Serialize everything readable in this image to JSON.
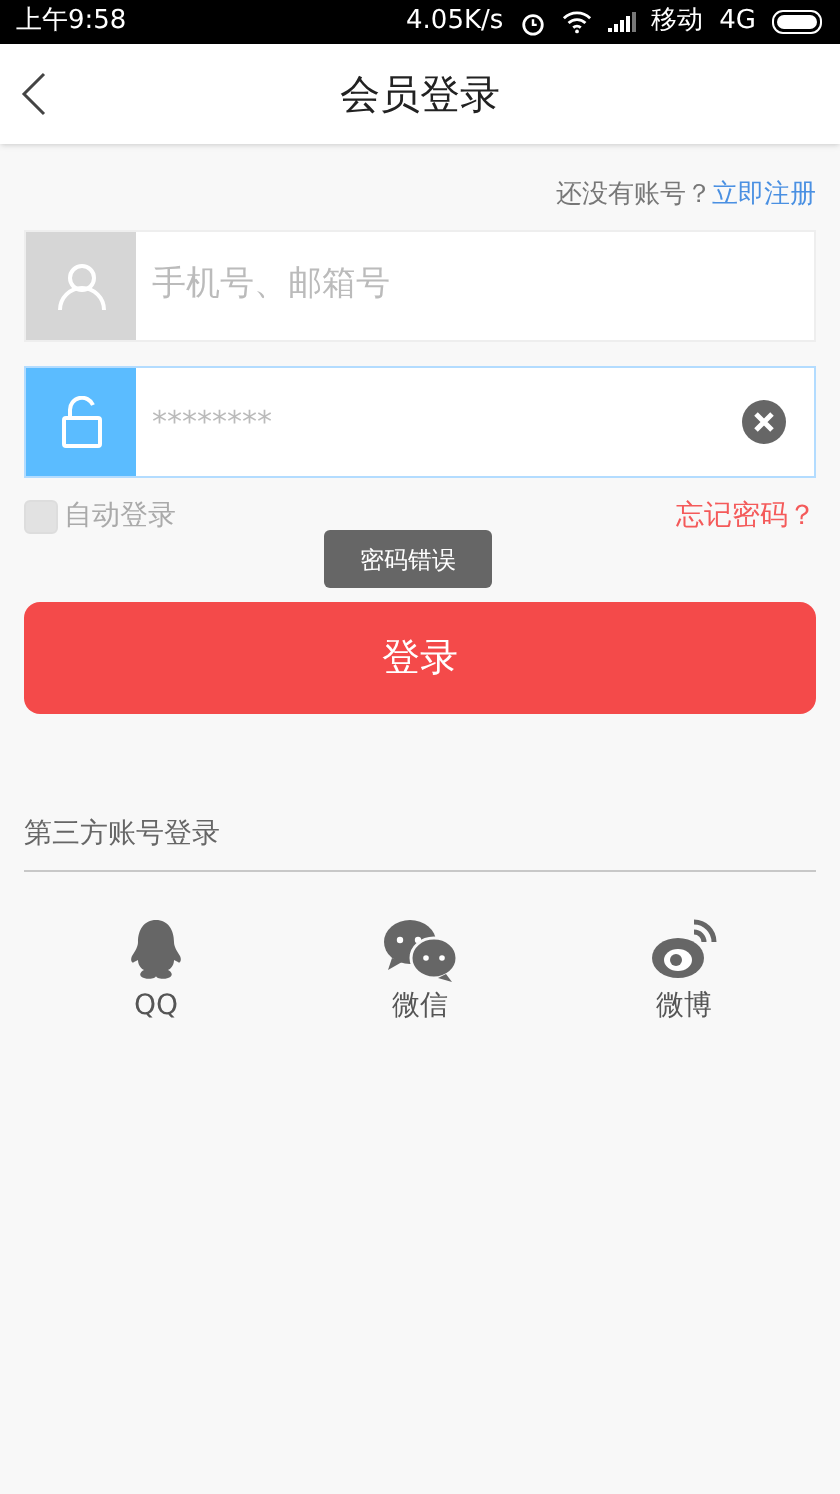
{
  "status_bar": {
    "time": "上午9:58",
    "speed": "4.05K/s",
    "carrier": "移动",
    "network": "4G"
  },
  "header": {
    "title": "会员登录"
  },
  "register": {
    "prompt": "还没有账号？",
    "link": "立即注册"
  },
  "username": {
    "placeholder": "手机号、邮箱号",
    "focused": false
  },
  "password": {
    "value": "********",
    "focused": true
  },
  "auto_login": {
    "label": "自动登录",
    "checked": false
  },
  "forgot_link": "忘记密码？",
  "toast": "密码错误",
  "login_button": "登录",
  "third_party": {
    "title": "第三方账号登录",
    "providers": [
      {
        "kind": "qq",
        "label": "QQ"
      },
      {
        "kind": "wechat",
        "label": "微信"
      },
      {
        "kind": "weibo",
        "label": "微博"
      }
    ]
  }
}
